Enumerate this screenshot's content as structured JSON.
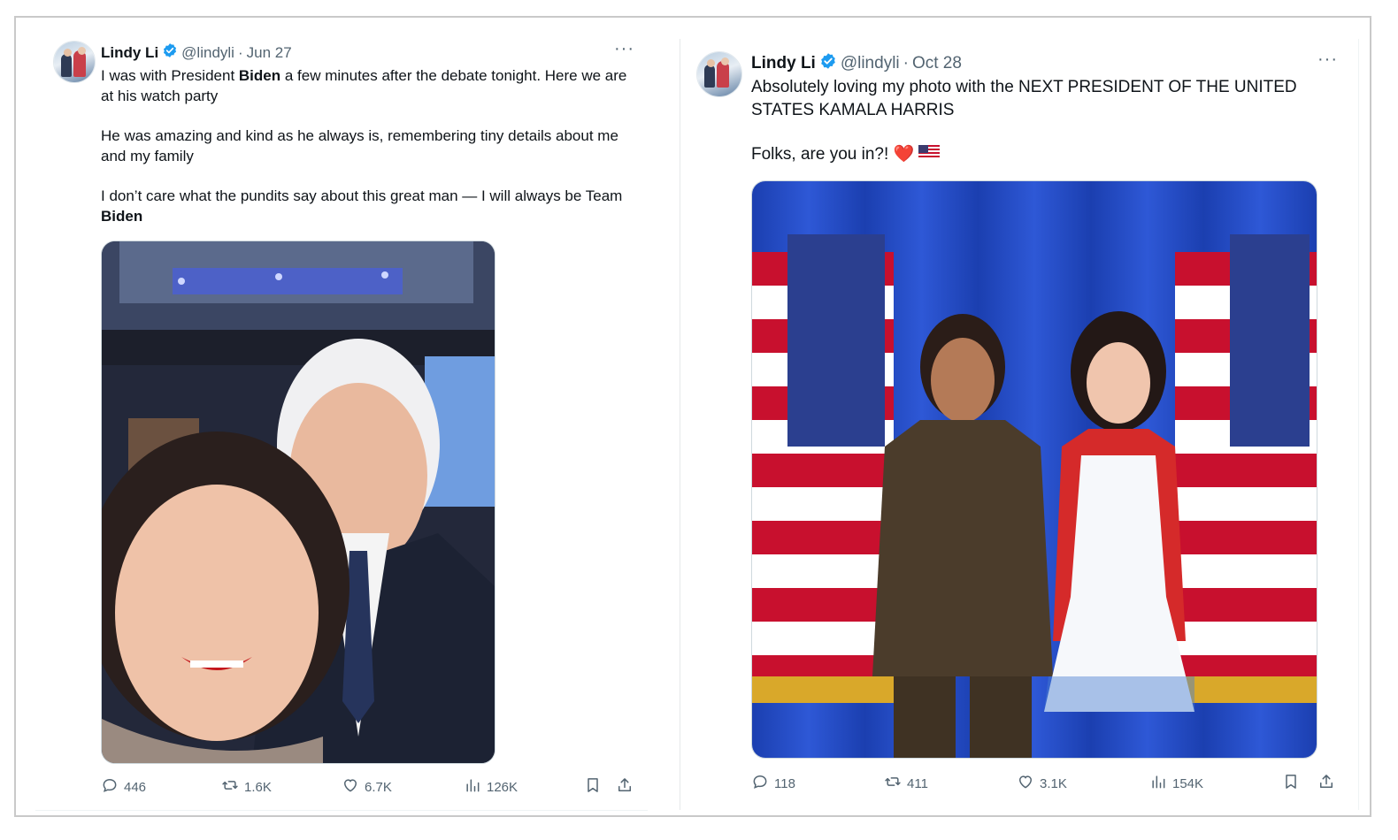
{
  "tweets": [
    {
      "author": {
        "name": "Lindy Li",
        "handle": "@lindyli"
      },
      "separator": "·",
      "date": "Jun 27",
      "more_label": "···",
      "text": {
        "p1": {
          "a": "I was with President ",
          "b": "Biden",
          "c": " a few minutes after the debate tonight. Here we are at his watch party"
        },
        "p2": "He was amazing and kind as he always is, remembering tiny details about me and my family",
        "p3": {
          "a": "I don’t care what the pundits say about this great man — I will always be Team ",
          "b": "Biden"
        }
      },
      "stats": {
        "replies": "446",
        "reposts": "1.6K",
        "likes": "6.7K",
        "views": "126K"
      }
    },
    {
      "author": {
        "name": "Lindy Li",
        "handle": "@lindyli"
      },
      "separator": "·",
      "date": "Oct 28",
      "more_label": "···",
      "text": {
        "p1": "Absolutely loving my photo with the NEXT PRESIDENT OF THE UNITED STATES KAMALA HARRIS",
        "p2": "Folks, are you in?!",
        "p2_emoji": "❤️"
      },
      "stats": {
        "replies": "118",
        "reposts": "411",
        "likes": "3.1K",
        "views": "154K"
      }
    }
  ],
  "colors": {
    "verified": "#1d9bf0",
    "text": "#0f1419",
    "muted": "#536471",
    "heart": "#e0245e"
  },
  "icons": [
    "verified-badge-icon",
    "reply-icon",
    "repost-icon",
    "like-icon",
    "views-icon",
    "bookmark-icon",
    "share-icon",
    "more-icon",
    "heart-emoji-icon",
    "us-flag-emoji-icon"
  ]
}
